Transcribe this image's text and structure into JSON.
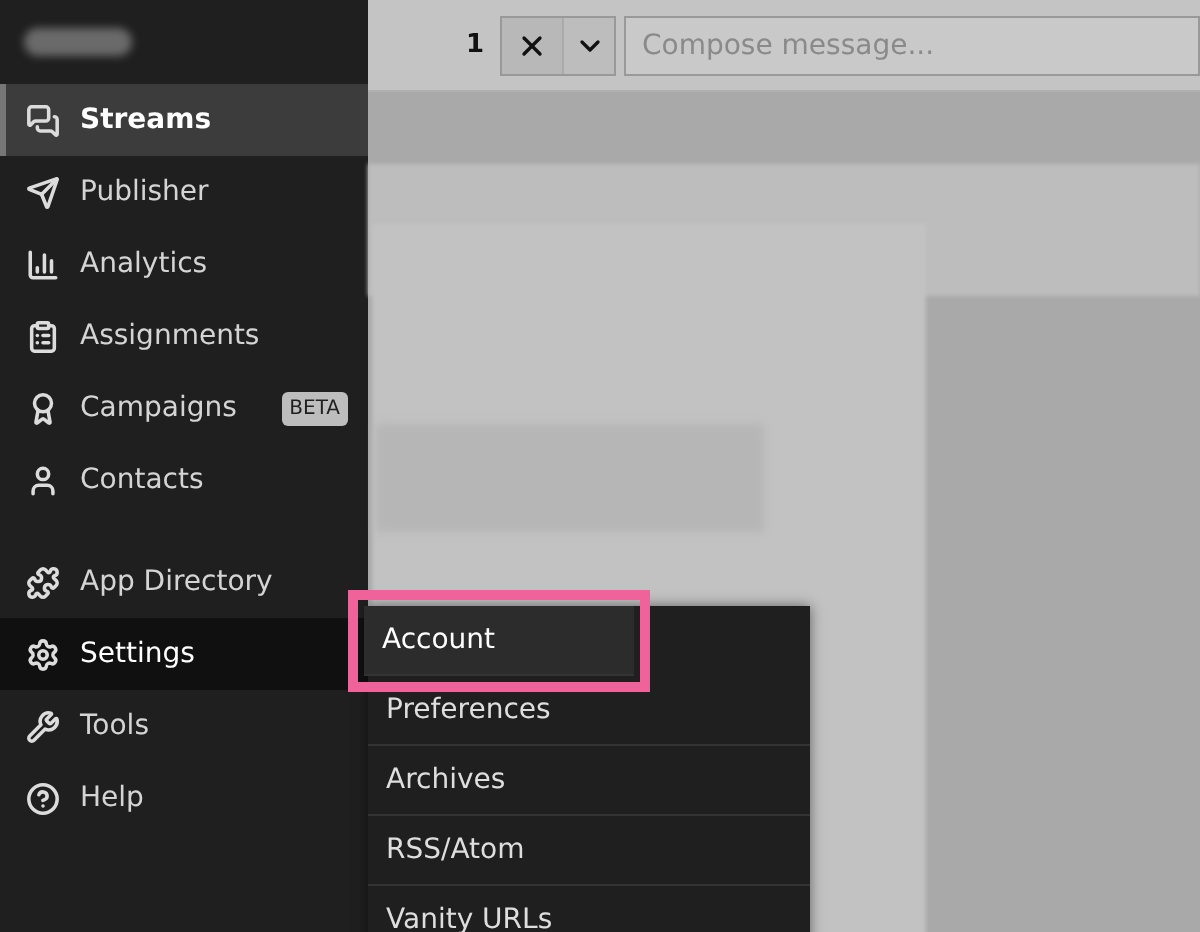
{
  "sidebar": {
    "items": [
      {
        "label": "Streams",
        "selected": true,
        "expanded": false
      },
      {
        "label": "Publisher",
        "selected": false,
        "expanded": false
      },
      {
        "label": "Analytics",
        "selected": false,
        "expanded": false
      },
      {
        "label": "Assignments",
        "selected": false,
        "expanded": false
      },
      {
        "label": "Campaigns",
        "selected": false,
        "expanded": false,
        "badge": "BETA"
      },
      {
        "label": "Contacts",
        "selected": false,
        "expanded": false
      },
      {
        "label": "App Directory",
        "selected": false,
        "expanded": false
      },
      {
        "label": "Settings",
        "selected": false,
        "expanded": true
      },
      {
        "label": "Tools",
        "selected": false,
        "expanded": false
      },
      {
        "label": "Help",
        "selected": false,
        "expanded": false
      }
    ]
  },
  "toolbar": {
    "count": "1",
    "compose": {
      "placeholder": "Compose message..."
    }
  },
  "settings_menu": {
    "items": [
      {
        "label": "Account",
        "selected": true
      },
      {
        "label": "Preferences",
        "selected": false
      },
      {
        "label": "Archives",
        "selected": false
      },
      {
        "label": "RSS/Atom",
        "selected": false
      },
      {
        "label": "Vanity URLs",
        "selected": false
      }
    ]
  }
}
